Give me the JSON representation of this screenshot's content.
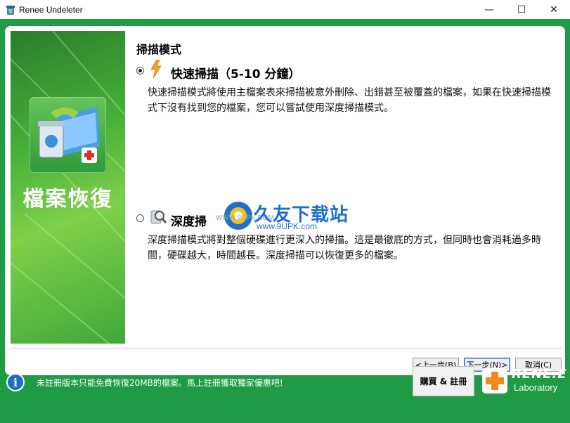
{
  "window": {
    "title": "Renee Undeleter",
    "icon": "recycle-app-icon",
    "controls": {
      "minimize": "—",
      "maximize": "☐",
      "close": "✕"
    }
  },
  "banner": {
    "title": "檔案恢復",
    "icon": "recycle-bin-folder-icon"
  },
  "main": {
    "section_title": "掃描模式",
    "options": [
      {
        "label": "快速掃描（5-10 分鐘）",
        "selected": true,
        "icon": "lightning-icon",
        "description": "快速掃描模式將使用主檔案表來掃描被意外刪除、出錯甚至被覆蓋的檔案，如果在快速掃描模式下沒有找到您的檔案，您可以嘗試使用深度掃描模式。"
      },
      {
        "label": "深度掃",
        "selected": false,
        "icon": "magnifier-icon",
        "description": "深度掃描模式將對整個硬碟進行更深入的掃描。這是最徹底的方式，但同時也會消耗過多時間，硬碟越大，時間越長。深度掃描可以恢復更多的檔案。"
      }
    ]
  },
  "watermark": {
    "brand": "久友下载站",
    "url": "www.9UPK.com",
    "url_small": "WWW.9UPK.COM"
  },
  "nav": {
    "back": "<上一步(B)",
    "next": "下一步(N)>",
    "cancel": "取消(C)"
  },
  "footer": {
    "notice": "未註冊版本只能免費恢復20MB的檔案。馬上註冊獲取獨家優惠吧!",
    "buy_button": "購買 & 註冊",
    "logo_name": "RENE.E",
    "logo_sub": "Laboratory"
  },
  "colors": {
    "frame_green": "#1f9b45",
    "accent_blue": "#2a6fd6"
  }
}
